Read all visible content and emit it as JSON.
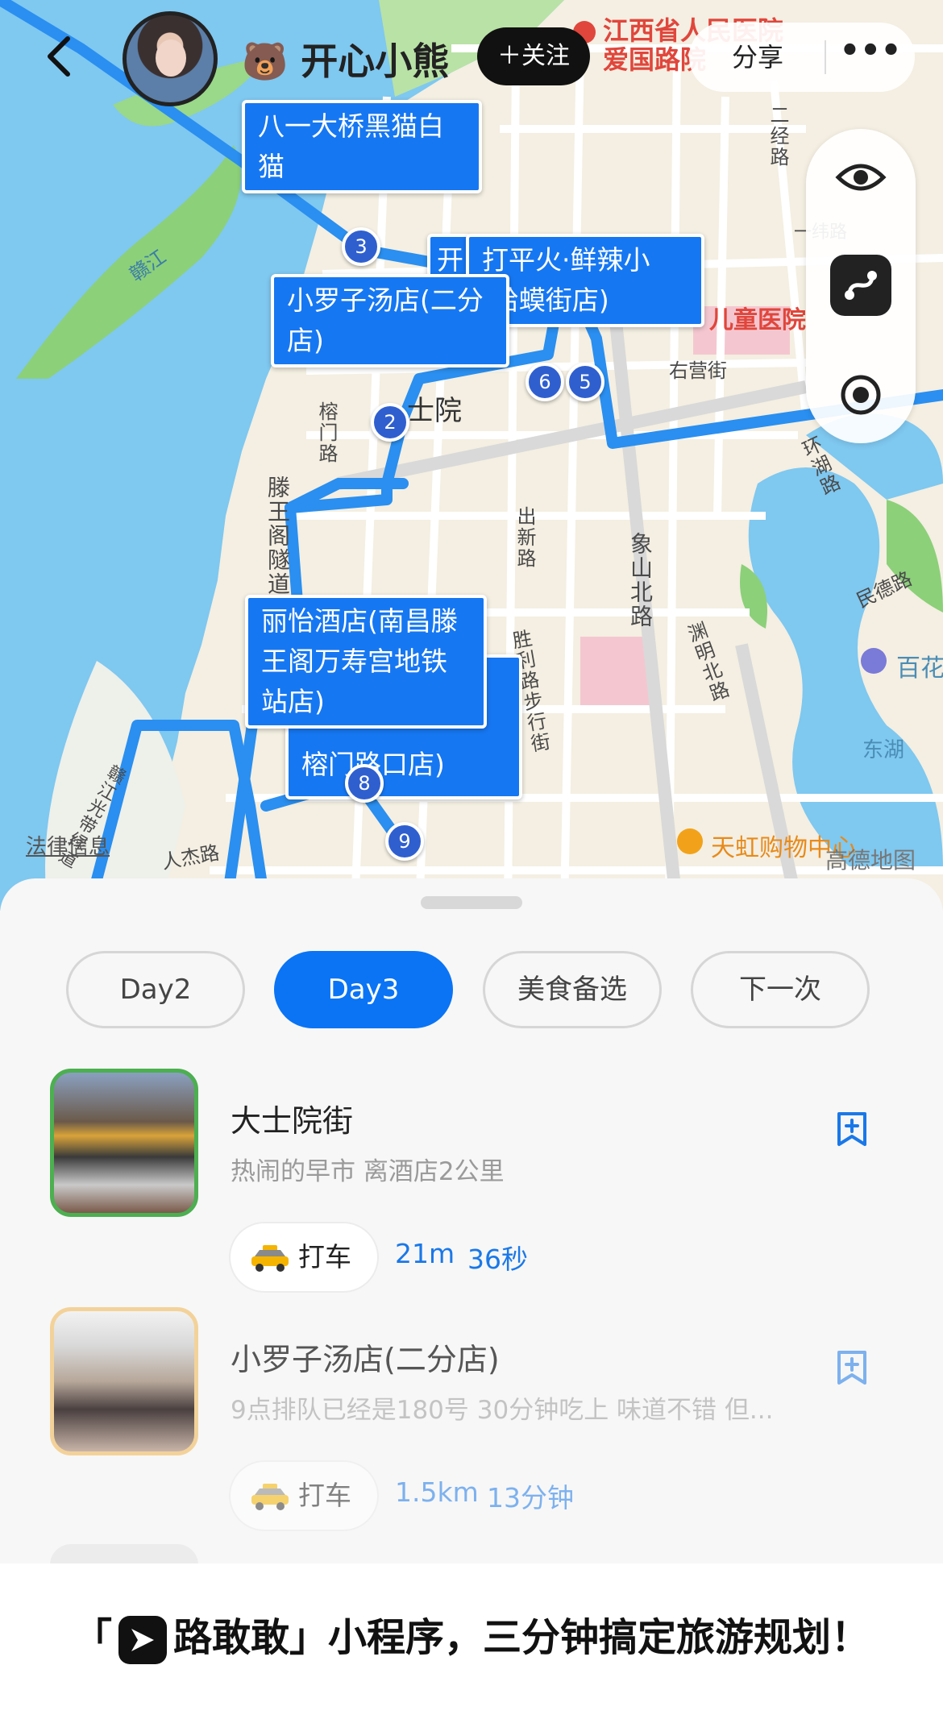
{
  "header": {
    "user_name": "🐻 开心小熊",
    "follow_label": "＋关注",
    "share_label": "分享",
    "more_label": "•••"
  },
  "map": {
    "callouts": [
      "八一大桥黑猫白猫",
      "打平火·鲜辣小 (蛤蟆街店)",
      "小罗子汤店(二分店)",
      "丽怡酒店(南昌滕王阁万寿宫地铁站店)",
      "榕门路口店)"
    ],
    "callout_partial_prefix": "开",
    "pins": [
      "3",
      "2",
      "6",
      "5",
      "8",
      "9"
    ],
    "labels": {
      "river": "赣江",
      "hospital_top": "江西省人民医院爱国路院",
      "children_hospital": "儿童医院",
      "road_youyingjie": "右营街",
      "road_rongmen": "榕门路",
      "road_tengwangge": "滕王阁隧道",
      "road_chuxin": "出新路",
      "road_xiangshanbei": "象山北路",
      "road_shengli": "胜利路步行街",
      "road_yuanming": "渊明北路",
      "road_huanhu": "环湖路",
      "road_minde": "民德路",
      "road_renjie": "人杰路",
      "road_erjing": "二经路",
      "road_yiwei": "一纬路",
      "road_jiangbin": "赣江光带绿道",
      "place_shiyuan": "士院",
      "place_baihua": "百花",
      "place_donghu": "东湖",
      "mall": "天虹购物中心",
      "legal": "法律信息",
      "amap": "高德地图"
    }
  },
  "tabs": [
    {
      "label": "Day2",
      "active": false
    },
    {
      "label": "Day3",
      "active": true
    },
    {
      "label": "美食备选",
      "active": false
    },
    {
      "label": "下一次",
      "active": false
    }
  ],
  "items": [
    {
      "title": "大士院街",
      "subtitle": "热闹的早市 离酒店2公里",
      "taxi_label": "打车",
      "distance": "21m",
      "duration": "36秒"
    },
    {
      "title": "小罗子汤店(二分店)",
      "subtitle": "9点排队已经是180号 30分钟吃上 味道不错 但...",
      "taxi_label": "打车",
      "distance": "1.5km",
      "duration": "13分钟"
    }
  ],
  "footer": {
    "prefix": "「",
    "brand": "路敢敢",
    "suffix": "」小程序，三分钟搞定旅游规划！"
  },
  "colors": {
    "primary_blue": "#0a74f5",
    "route_blue": "#2a8ff0",
    "pin_blue": "#2f5fcf",
    "water": "#7fc8f0",
    "park": "#8cd07a"
  }
}
